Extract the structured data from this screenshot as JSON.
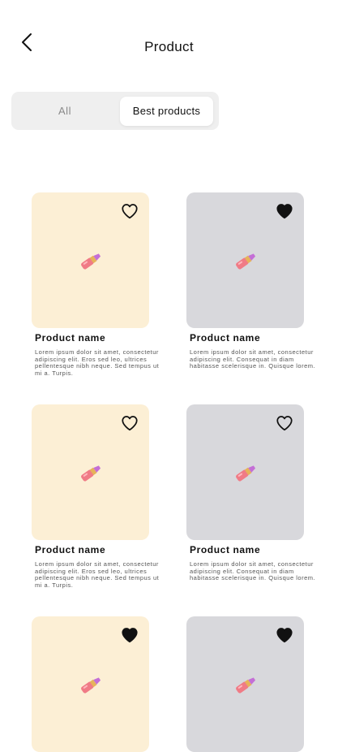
{
  "header": {
    "title": "Product",
    "back_icon": "chevron-left-icon"
  },
  "tabs": [
    {
      "label": "All",
      "selected": false
    },
    {
      "label": "Best products",
      "selected": true
    }
  ],
  "products": [
    {
      "name": "Product name",
      "description": "Lorem ipsum dolor sit amet, consectetur adipiscing elit. Eros sed leo, ultrices pellentesque nibh neque. Sed tempus ut mi a. Turpis.",
      "favorited": false,
      "bg": "#fcefd5",
      "image": "lipstick-icon"
    },
    {
      "name": "Product name",
      "description": "Lorem ipsum dolor sit amet, consectetur adipiscing elit. Consequat in diam habitasse scelerisque in. Quisque lorem.",
      "favorited": true,
      "bg": "#d8d8dc",
      "image": "lipstick-icon"
    },
    {
      "name": "Product name",
      "description": "Lorem ipsum dolor sit amet, consectetur adipiscing elit. Eros sed leo, ultrices pellentesque nibh neque. Sed tempus ut mi a. Turpis.",
      "favorited": false,
      "bg": "#fcefd5",
      "image": "lipstick-icon"
    },
    {
      "name": "Product name",
      "description": "Lorem ipsum dolor sit amet, consectetur adipiscing elit. Consequat in diam habitasse scelerisque in. Quisque lorem.",
      "favorited": false,
      "bg": "#d8d8dc",
      "image": "lipstick-icon"
    },
    {
      "name": "",
      "description": "",
      "favorited": true,
      "bg": "#fcefd5",
      "image": "lipstick-icon"
    },
    {
      "name": "",
      "description": "",
      "favorited": true,
      "bg": "#d8d8dc",
      "image": "lipstick-icon"
    }
  ]
}
